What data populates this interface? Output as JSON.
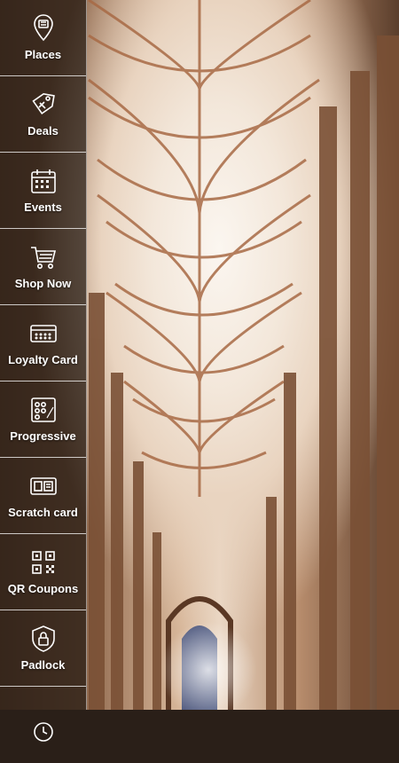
{
  "menu": {
    "items": [
      {
        "label": "Places",
        "icon": "map-pin-icon"
      },
      {
        "label": "Deals",
        "icon": "tag-icon"
      },
      {
        "label": "Events",
        "icon": "calendar-icon"
      },
      {
        "label": "Shop Now",
        "icon": "shopping-cart-icon"
      },
      {
        "label": "Loyalty Card",
        "icon": "loyalty-card-icon"
      },
      {
        "label": "Progressive",
        "icon": "progressive-card-icon"
      },
      {
        "label": "Scratch card",
        "icon": "scratch-card-icon"
      },
      {
        "label": "QR Coupons",
        "icon": "qr-code-icon"
      },
      {
        "label": "Padlock",
        "icon": "padlock-icon"
      },
      {
        "label": "",
        "icon": "more-icon"
      }
    ]
  },
  "colors": {
    "sidebar_bg": "#231912",
    "label_text": "#ffffff",
    "divider": "#ffffff"
  }
}
